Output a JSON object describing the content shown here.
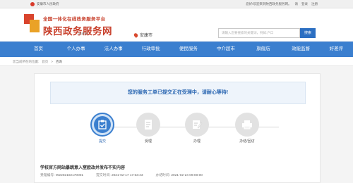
{
  "topbar": {
    "gov_link": "安康市人民政府",
    "welcome": "您好!欢迎来到陕西政务服务网。",
    "login": "请",
    "login_link": "登录",
    "register": "注册"
  },
  "header": {
    "logo_sub": "全国一体化在线政务服务平台",
    "logo_main": "陕西政务服务网",
    "logo_mini": "(安康市)",
    "location": "安康市",
    "search_placeholder": "请输入您要搜索的关键词，例如:户口",
    "search_button": "搜索"
  },
  "nav": {
    "items": [
      "首页",
      "个人办事",
      "法人办事",
      "行政审批",
      "便民服务",
      "中介超市",
      "旗舰店",
      "效能监督",
      "好差评"
    ]
  },
  "breadcrumb": {
    "prefix": "您当前所在的位置:",
    "home": "首页",
    "sep": ">",
    "current": "咨询"
  },
  "notice": {
    "text": "您的服务工单已提交正在受理中，请耐心等待!"
  },
  "steps": [
    {
      "label": "提交",
      "icon": "clipboard-check-icon",
      "active": true
    },
    {
      "label": "受理",
      "icon": "document-icon",
      "active": false
    },
    {
      "label": "办理",
      "icon": "pen-document-icon",
      "active": false
    },
    {
      "label": "办结/回访",
      "icon": "print-icon",
      "active": false
    }
  ],
  "matter": {
    "title": "学校官方网站暴跳意入窒欧改并发布不实内容",
    "number_label": "受理编号:",
    "number_value": "W2202102170001",
    "submit_label": "提交时间:",
    "submit_value": "2021-02-17 17:53:43",
    "deadline_label": "办结时间:",
    "deadline_value": "2021-02-24 09:00:00"
  },
  "colors": {
    "nav_bg": "#3b7fcf",
    "brand_red": "#c8402c",
    "accent_blue": "#2c6fc2"
  }
}
